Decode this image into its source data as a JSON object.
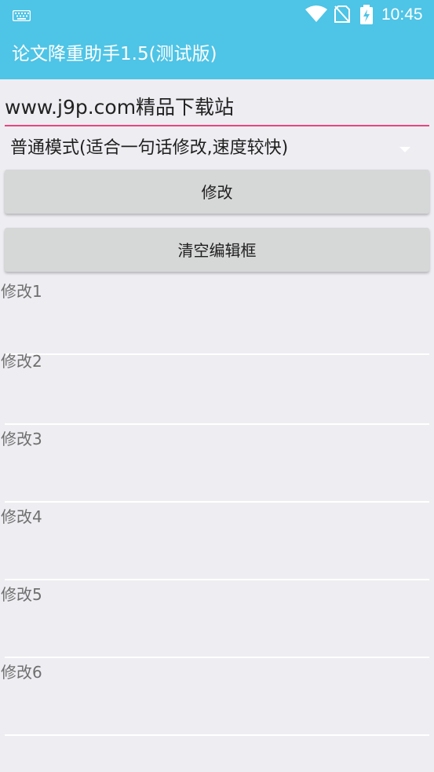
{
  "status_bar": {
    "time": "10:45",
    "icons": [
      "keyboard-icon",
      "wifi-icon",
      "no-sim-icon",
      "battery-charging-icon"
    ]
  },
  "app_bar": {
    "title": "论文降重助手1.5(测试版)"
  },
  "input": {
    "value": "www.j9p.com精品下载站"
  },
  "mode_select": {
    "selected": "普通模式(适合一句话修改,速度较快)"
  },
  "buttons": {
    "modify": "修改",
    "clear": "清空编辑框"
  },
  "results": [
    {
      "label": "修改1"
    },
    {
      "label": "修改2"
    },
    {
      "label": "修改3"
    },
    {
      "label": "修改4"
    },
    {
      "label": "修改5"
    },
    {
      "label": "修改6"
    }
  ],
  "colors": {
    "primary": "#4ec4e6",
    "accent": "#e8457e",
    "background": "#eeedf2",
    "button": "#d6d7d7"
  }
}
